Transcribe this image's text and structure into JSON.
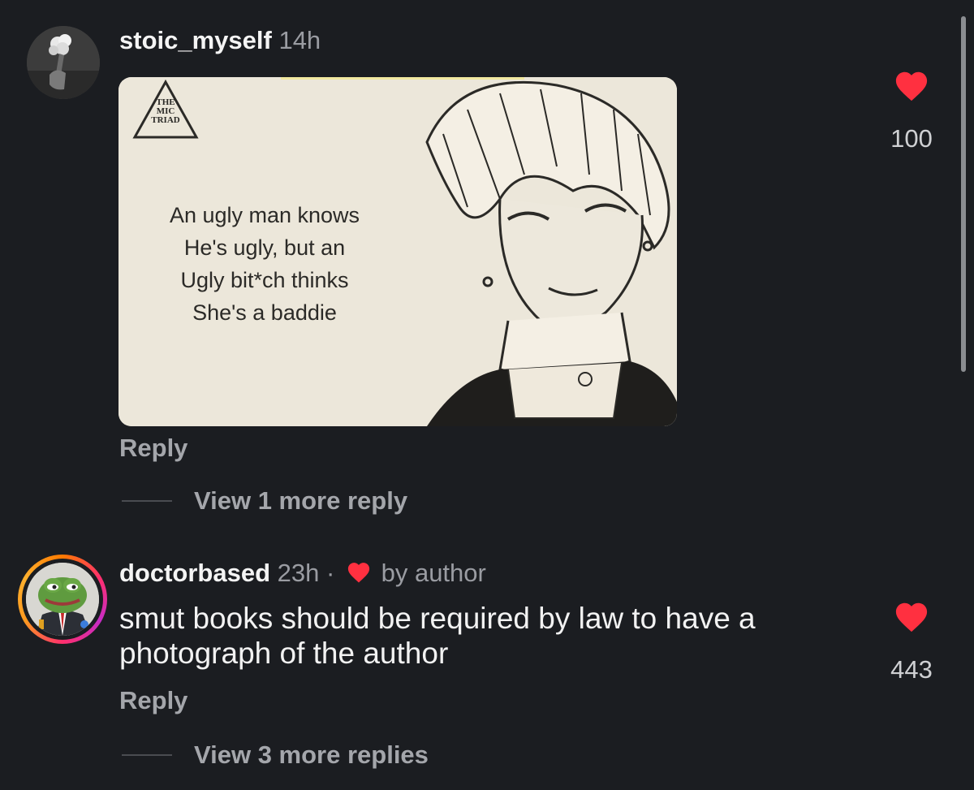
{
  "colors": {
    "background": "#1b1d21",
    "heart": "#ff3040",
    "muted_text": "#9a9ca2"
  },
  "comments": [
    {
      "username": "stoic_myself",
      "time": "14h",
      "image": {
        "logo_text": [
          "THE",
          "MIC",
          "TRIAD"
        ],
        "caption_lines": [
          "An ugly man knows",
          "He's ugly, but an",
          "Ugly bit*ch thinks",
          "She's a baddie"
        ]
      },
      "reply_label": "Reply",
      "more_replies": "View 1 more reply",
      "likes": "100",
      "like_icon": "heart-icon"
    },
    {
      "username": "doctorbased",
      "time": "23h",
      "separator": "·",
      "author_badge": "by author",
      "text_lines": [
        "smut books should be required by law to have a",
        "photograph of the author"
      ],
      "reply_label": "Reply",
      "more_replies": "View 3 more replies",
      "likes": "443",
      "like_icon": "heart-icon"
    }
  ]
}
